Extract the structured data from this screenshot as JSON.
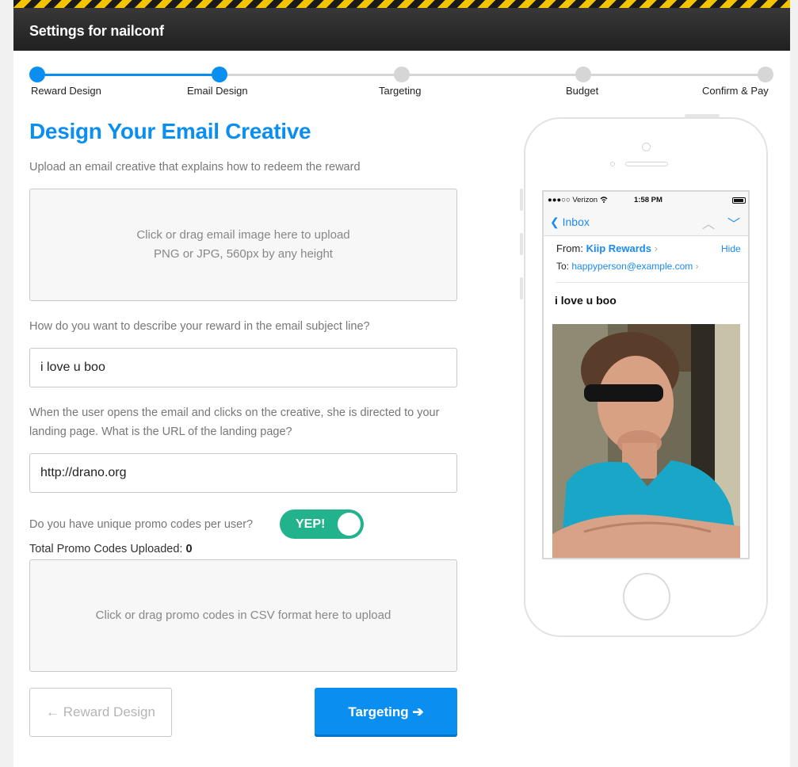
{
  "header": {
    "title": "Settings for nailconf"
  },
  "stepper": {
    "steps": [
      {
        "label": "Reward Design",
        "state": "complete"
      },
      {
        "label": "Email Design",
        "state": "current"
      },
      {
        "label": "Targeting",
        "state": "upcoming"
      },
      {
        "label": "Budget",
        "state": "upcoming"
      },
      {
        "label": "Confirm & Pay",
        "state": "upcoming"
      }
    ],
    "progress": 0.25,
    "accent_color": "#0a8ff0"
  },
  "form": {
    "heading": "Design Your Email Creative",
    "upload_hint": "Upload an email creative that explains how to redeem the reward",
    "image_drop": {
      "line1": "Click or drag email image here to upload",
      "line2": "PNG or JPG, 560px by any height"
    },
    "subject_question": "How do you want to describe your reward in the email subject line?",
    "subject_value": "i love u boo",
    "url_question": "When the user opens the email and clicks on the creative, she is directed to your landing page. What is the URL of the landing page?",
    "url_value": "http://drano.org",
    "promo_question": "Do you have unique promo codes per user?",
    "promo_toggle": {
      "label": "YEP!",
      "on": true,
      "color": "#22b38c"
    },
    "promo_count_label": "Total Promo Codes Uploaded:",
    "promo_count_value": "0",
    "csv_drop": "Click or drag promo codes in CSV format here to upload",
    "back_button": {
      "icon": "arrow-left-icon",
      "glyph": "←",
      "label": "Reward Design"
    },
    "next_button": {
      "label": "Targeting",
      "icon": "arrow-right-icon",
      "glyph": "➔"
    }
  },
  "preview": {
    "status_bar": {
      "carrier": "●●●○○ Verizon",
      "time": "1:58 PM"
    },
    "nav": {
      "back_label": "Inbox",
      "chevron": "❮",
      "up_glyph": "︿",
      "down_glyph": "﹀"
    },
    "email": {
      "from_label": "From:",
      "from_name": "Kiip Rewards",
      "hide_label": "Hide",
      "to_label": "To:",
      "to_address": "happyperson@example.com",
      "link_chevron": "›",
      "subject": "i love u boo"
    },
    "photo_icon": "person-photo"
  }
}
